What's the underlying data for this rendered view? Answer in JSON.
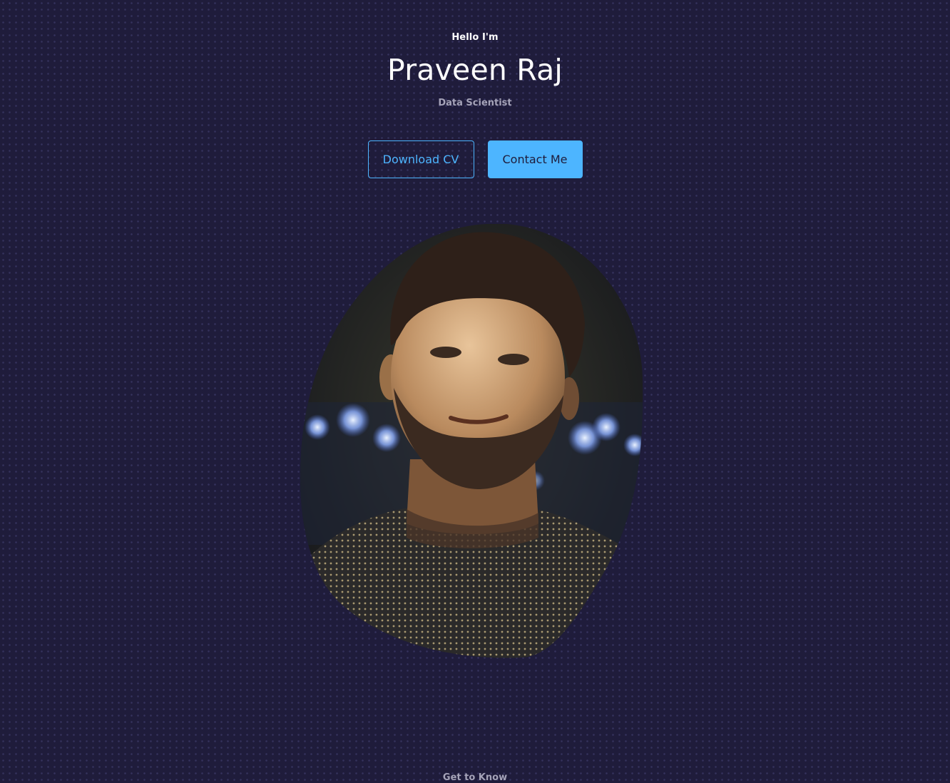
{
  "hero": {
    "greeting": "Hello I'm",
    "name": "Praveen Raj",
    "role": "Data Scientist",
    "buttons": {
      "download_cv": "Download CV",
      "contact_me": "Contact Me"
    },
    "next_section_label": "Get to Know"
  },
  "theme": {
    "background": "#1f1c3b",
    "accent": "#4db5ff",
    "muted_text": "#a5a3b8"
  }
}
